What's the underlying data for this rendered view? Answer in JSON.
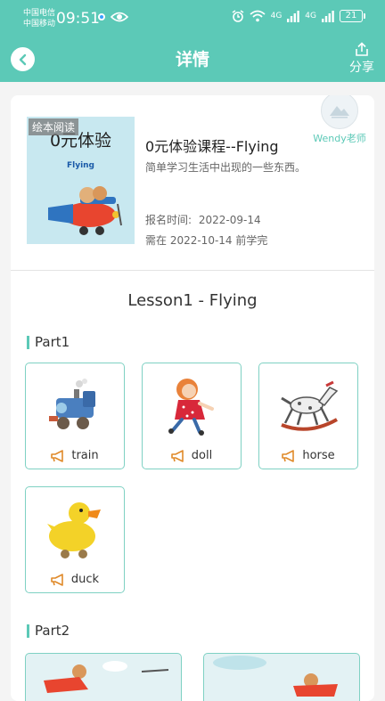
{
  "status_bar": {
    "carrier1": "中国电信",
    "carrier2": "中国移动",
    "time": "09:51",
    "signal1": "4G",
    "signal2": "4G",
    "battery": "21"
  },
  "header": {
    "title": "详情",
    "share_label": "分享",
    "color": "#5cc9b7"
  },
  "course": {
    "cover_tag": "绘本阅读",
    "cover_title": "0元体验",
    "cover_subtitle": "Flying",
    "name": "0元体验课程--Flying",
    "description": "简单学习生活中出现的一些东西。",
    "signup_label": "报名时间:",
    "signup_date": "2022-09-14",
    "deadline_text": "需在 2022-10-14 前学完",
    "teacher": "Wendy老师"
  },
  "lesson": {
    "title": "Lesson1 - Flying",
    "parts": [
      {
        "title": "Part1",
        "words": [
          {
            "word": "train",
            "icon": "train-icon"
          },
          {
            "word": "doll",
            "icon": "doll-icon"
          },
          {
            "word": "horse",
            "icon": "rocking-horse-icon"
          },
          {
            "word": "duck",
            "icon": "duck-icon"
          }
        ]
      },
      {
        "title": "Part2"
      }
    ]
  }
}
